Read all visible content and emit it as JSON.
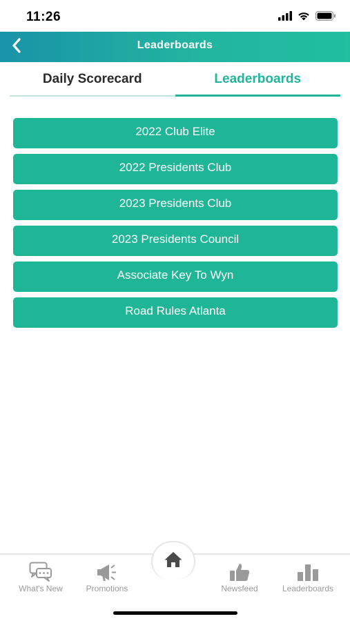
{
  "status": {
    "time": "11:26"
  },
  "header": {
    "title": "Leaderboards"
  },
  "tabs": [
    {
      "label": "Daily Scorecard",
      "active": false
    },
    {
      "label": "Leaderboards",
      "active": true
    }
  ],
  "leaderboards": [
    "2022 Club Elite",
    "2022 Presidents Club",
    "2023 Presidents Club",
    "2023 Presidents Council",
    "Associate Key To Wyn",
    "Road Rules Atlanta"
  ],
  "tab_bar": {
    "items": [
      {
        "label": "What's New",
        "icon": "chat-bubbles-icon"
      },
      {
        "label": "Promotions",
        "icon": "megaphone-icon"
      },
      {
        "label": "",
        "icon": "home-icon"
      },
      {
        "label": "Newsfeed",
        "icon": "thumbs-up-icon"
      },
      {
        "label": "Leaderboards",
        "icon": "bar-chart-icon"
      }
    ]
  },
  "colors": {
    "accent": "#1fb597",
    "header_start": "#1a93a8",
    "header_end": "#20bfa0",
    "inactive_icon": "#9a9a9a"
  }
}
